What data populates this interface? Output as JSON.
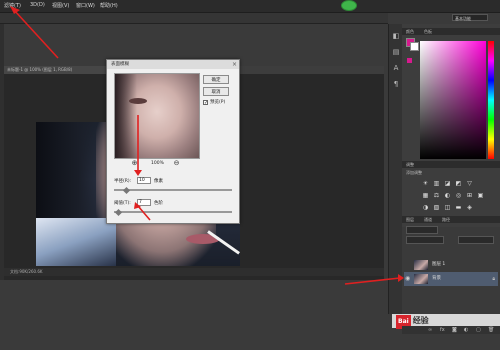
{
  "menu": {
    "filter": "滤镜(T)",
    "3d": "3D(D)",
    "view": "视图(V)",
    "window": "窗口(W)",
    "help": "帮助(H)"
  },
  "workspace": {
    "essentials": "基本功能"
  },
  "document": {
    "tab_label": "未标题-1 @ 100% (图层 1, RGB/8)",
    "status_text": "文档:90K/260.6K"
  },
  "dialog": {
    "title": "表面模糊",
    "ok_label": "确定",
    "cancel_label": "取消",
    "preview_label": "预览(P)",
    "preview_checked": true,
    "zoom_level": "100%",
    "radius_label": "半径(R):",
    "radius_value": "10",
    "radius_unit": "像素",
    "radius_fraction": 0.1,
    "threshold_label": "阈值(T):",
    "threshold_value": "7",
    "threshold_unit": "色阶",
    "threshold_fraction": 0.03
  },
  "panels": {
    "color_tabs": [
      "颜色",
      "色板"
    ],
    "adjustments_tab": "调整",
    "adjustments_sub": "添加调整",
    "layers_tabs": [
      "图层",
      "通道",
      "路径"
    ],
    "foreground_color": "#d61a8e",
    "background_color": "#ffffff"
  },
  "layers": [
    {
      "name": "图层 1",
      "visible": false
    },
    {
      "name": "背景",
      "visible": true,
      "locked": true
    }
  ],
  "watermark": {
    "badge": "Bai",
    "text": "经验"
  },
  "icons": [
    "search-icon",
    "zoom-in-icon",
    "zoom-out-icon",
    "eye-icon",
    "lock-icon",
    "close-icon",
    "link-icon",
    "fx-icon",
    "mask-icon",
    "new-layer-icon",
    "trash-icon"
  ],
  "colors": {
    "annotation": "#e02020",
    "ps_badge": "#3fb54a"
  }
}
